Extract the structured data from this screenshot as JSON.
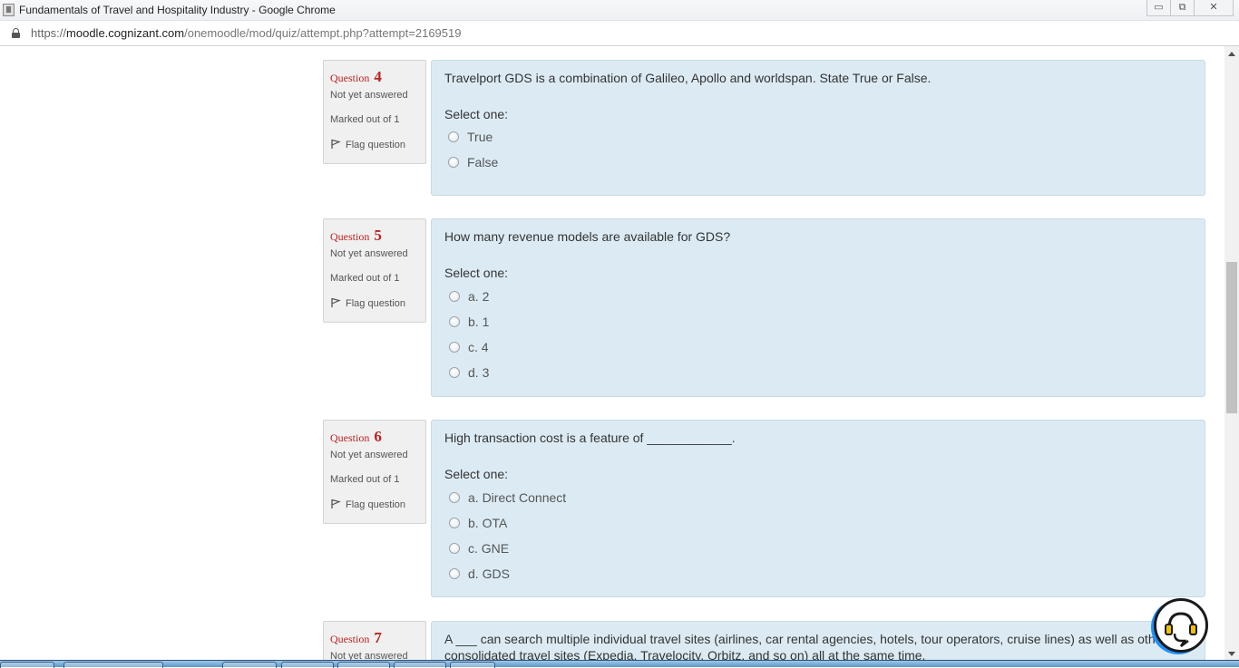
{
  "window": {
    "title": "Fundamentals of Travel and Hospitality Industry - Google Chrome",
    "controls": {
      "minimize": "▭",
      "restore": "⧉",
      "close": "✕"
    }
  },
  "addressbar": {
    "scheme": "https://",
    "host": "moodle.cognizant.com",
    "path": "/onemoodle/mod/quiz/attempt.php?attempt=2169519"
  },
  "questions": [
    {
      "label": "Question",
      "number": "4",
      "state": "Not yet answered",
      "grade": "Marked out of 1",
      "flag": "Flag question",
      "text": "Travelport GDS is a combination of Galileo, Apollo and worldspan. State True or False.",
      "prompt": "Select one:",
      "options": [
        "True",
        "False"
      ]
    },
    {
      "label": "Question",
      "number": "5",
      "state": "Not yet answered",
      "grade": "Marked out of 1",
      "flag": "Flag question",
      "text": "How many revenue models are available for GDS?",
      "prompt": "Select one:",
      "options": [
        "a. 2",
        "b. 1",
        "c. 4",
        "d. 3"
      ]
    },
    {
      "label": "Question",
      "number": "6",
      "state": "Not yet answered",
      "grade": "Marked out of 1",
      "flag": "Flag question",
      "text": "High transaction cost is a feature of ____________.",
      "prompt": "Select one:",
      "options": [
        "a. Direct Connect",
        "b. OTA",
        "c. GNE",
        "d. GDS"
      ]
    },
    {
      "label": "Question",
      "number": "7",
      "state": "Not yet answered",
      "text": "A ___ can search multiple individual travel sites (airlines, car rental agencies, hotels, tour operators, cruise lines) as well as other consolidated travel sites (Expedia, Travelocity, Orbitz, and so on) all at the same time."
    }
  ],
  "colors": {
    "question_number": "#bb2222",
    "info_bg": "#f0f0f0",
    "content_bg": "#dcebf3"
  },
  "icons": {
    "lock": "lock-icon",
    "flag": "flag-icon",
    "help": "headset-help-icon"
  }
}
